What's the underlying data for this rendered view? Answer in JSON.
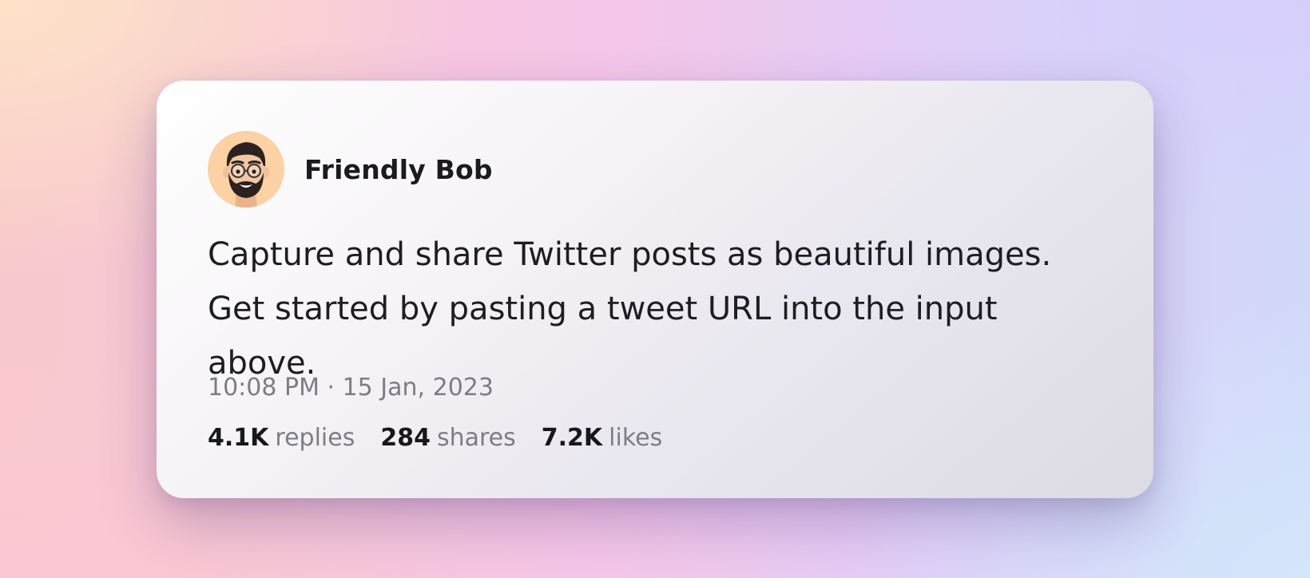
{
  "tweet": {
    "author_name": "Friendly Bob",
    "avatar_icon": "memoji-avatar-icon",
    "text": "Capture and share Twitter posts as beautiful images. Get started by pasting a tweet URL into the input above.",
    "timestamp": "10:08 PM · 15 Jan, 2023",
    "stats": {
      "replies_value": "4.1K",
      "replies_label": "replies",
      "shares_value": "284",
      "shares_label": "shares",
      "likes_value": "7.2K",
      "likes_label": "likes"
    }
  },
  "colors": {
    "avatar_bg": "#fcd1a3",
    "text_primary": "#1d1d22",
    "text_secondary": "#7d7d84"
  }
}
